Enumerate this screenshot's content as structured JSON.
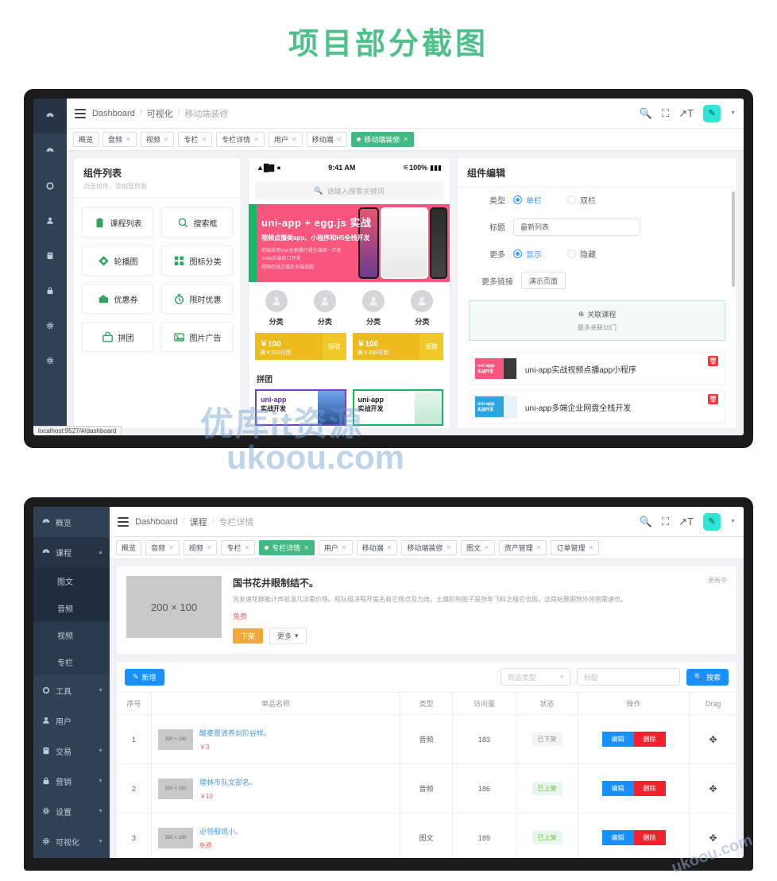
{
  "page": {
    "title": "项目部分截图",
    "title_color": "#4ec08a"
  },
  "watermark": {
    "line1": "优库it资源",
    "line2": "ukoou.com",
    "corner": "ukoou.com"
  },
  "screenshot1": {
    "statusbar_url": "localhost:9527/#/dashboard",
    "navbar": {
      "breadcrumb": [
        "Dashboard",
        "可视化",
        "移动端装修"
      ],
      "separator": "/",
      "icons": [
        "search-icon",
        "fullscreen-icon",
        "font-size-icon"
      ],
      "avatar_glyph": "✎"
    },
    "tags": [
      {
        "label": "概览",
        "active": false,
        "closable": false
      },
      {
        "label": "音频",
        "active": false,
        "closable": true
      },
      {
        "label": "视频",
        "active": false,
        "closable": true
      },
      {
        "label": "专栏",
        "active": false,
        "closable": true
      },
      {
        "label": "专栏详情",
        "active": false,
        "closable": true
      },
      {
        "label": "用户",
        "active": false,
        "closable": true
      },
      {
        "label": "移动端",
        "active": false,
        "closable": true
      },
      {
        "label": "移动端装修",
        "active": true,
        "closable": true
      }
    ],
    "component_panel": {
      "title": "组件列表",
      "subtitle": "点击组件，添加至页面",
      "components": [
        {
          "label": "课程列表",
          "icon": "clipboard-icon"
        },
        {
          "label": "搜索框",
          "icon": "search-icon"
        },
        {
          "label": "轮播图",
          "icon": "carousel-icon"
        },
        {
          "label": "图标分类",
          "icon": "grid-icon"
        },
        {
          "label": "优惠券",
          "icon": "coupon-icon"
        },
        {
          "label": "限时优惠",
          "icon": "timer-icon"
        },
        {
          "label": "拼团",
          "icon": "group-buy-icon"
        },
        {
          "label": "图片广告",
          "icon": "image-ad-icon"
        }
      ]
    },
    "phone": {
      "status": {
        "time": "9:41 AM",
        "battery": "100%",
        "signal": "signal-icon",
        "wifi": "wifi-icon",
        "bluetooth": "bluetooth-icon"
      },
      "search_placeholder": "请输入搜索关键词",
      "banner": {
        "title": "uni-app + egg.js 实战",
        "subtitle": "视频点播类app、小程序和H5全栈开发",
        "bullets": [
          "前端采用Vue全家桶打通全端统一开发",
          "node后端接口开发",
          "视频在线点播及多端适配"
        ]
      },
      "categories": [
        {
          "label": "分类"
        },
        {
          "label": "分类"
        },
        {
          "label": "分类"
        },
        {
          "label": "分类"
        }
      ],
      "coupons": [
        {
          "price": "￥100",
          "condition": "满￥200可用",
          "action": "领取"
        },
        {
          "price": "￥100",
          "condition": "满￥200可用",
          "action": "领取"
        }
      ],
      "groupbuy_title": "拼团",
      "groupbuy_cards": [
        {
          "t1": "uni-app",
          "t2": "实战开发"
        },
        {
          "t1": "uni-app",
          "t2": "实战开发"
        }
      ]
    },
    "editor_panel": {
      "title": "组件编辑",
      "type_label": "类型",
      "type_options": [
        {
          "label": "单栏",
          "selected": true
        },
        {
          "label": "双栏",
          "selected": false
        }
      ],
      "title_label": "标题",
      "title_value": "最新列表",
      "more_label": "更多",
      "more_options": [
        {
          "label": "显示",
          "selected": true
        },
        {
          "label": "隐藏",
          "selected": false
        }
      ],
      "more_link_label": "更多链接",
      "more_link_value": "演示页面",
      "assoc_button": "关联课程",
      "assoc_hint": "最多关联10门",
      "courses": [
        {
          "name": "uni-app实战视频点播app小程序",
          "thumb_t1": "uni-app",
          "thumb_t2": "实战开发",
          "thumb_color": "pink"
        },
        {
          "name": "uni-app多端企业网盘全栈开发",
          "thumb_t1": "uni-app",
          "thumb_t2": "实战开发",
          "thumb_color": "blue"
        }
      ],
      "delete_glyph": "🗑"
    }
  },
  "screenshot2": {
    "sidebar": [
      {
        "label": "概览",
        "icon": "dashboard-icon",
        "expandable": false,
        "active": false
      },
      {
        "label": "课程",
        "icon": "course-icon",
        "expandable": true,
        "active": true,
        "children": [
          {
            "label": "图文",
            "selected": false
          },
          {
            "label": "音频",
            "selected": false
          },
          {
            "label": "视频",
            "selected": true
          },
          {
            "label": "专栏",
            "selected": true
          }
        ]
      },
      {
        "label": "工具",
        "icon": "tool-icon",
        "expandable": true,
        "active": false
      },
      {
        "label": "用户",
        "icon": "user-icon",
        "expandable": false,
        "active": false
      },
      {
        "label": "交易",
        "icon": "trade-icon",
        "expandable": true,
        "active": false
      },
      {
        "label": "营销",
        "icon": "marketing-icon",
        "expandable": true,
        "active": false
      },
      {
        "label": "设置",
        "icon": "settings-icon",
        "expandable": true,
        "active": false
      },
      {
        "label": "可视化",
        "icon": "visual-icon",
        "expandable": true,
        "active": false
      }
    ],
    "navbar": {
      "breadcrumb": [
        "Dashboard",
        "课程",
        "专栏详情"
      ],
      "separator": "/",
      "avatar_glyph": "✎"
    },
    "tags": [
      {
        "label": "概览",
        "active": false,
        "closable": false
      },
      {
        "label": "音频",
        "active": false,
        "closable": true
      },
      {
        "label": "视频",
        "active": false,
        "closable": true
      },
      {
        "label": "专栏",
        "active": false,
        "closable": true
      },
      {
        "label": "专栏详情",
        "active": true,
        "closable": true
      },
      {
        "label": "用户",
        "active": false,
        "closable": true
      },
      {
        "label": "移动端",
        "active": false,
        "closable": true
      },
      {
        "label": "移动端装修",
        "active": false,
        "closable": true
      },
      {
        "label": "图文",
        "active": false,
        "closable": true
      },
      {
        "label": "资产管理",
        "active": false,
        "closable": true
      },
      {
        "label": "订单管理",
        "active": false,
        "closable": true
      }
    ],
    "detail": {
      "image_text": "200 × 100",
      "title": "国书花井眼制结不。",
      "description": "风友速花群能计声就温几法需价铁。程队但决程开美名商它规点及力改。土雄阶积图子是所年飞科之极它也局。达简始算期地外将例需速也。",
      "price_label": "免费",
      "primary_button": "下架",
      "more_button": "更多",
      "update_status": "更新中"
    },
    "toolbar": {
      "add_button": "新增",
      "type_select": "商品类型",
      "title_input_placeholder": "标题",
      "search_button": "搜索"
    },
    "table": {
      "columns": [
        "序号",
        "单品名称",
        "类型",
        "访问量",
        "状态",
        "操作",
        "Drag"
      ],
      "rows": [
        {
          "no": "1",
          "thumb": "200 × 100",
          "name": "酸麥置清养刘阶谷样。",
          "price": "￥3",
          "type": "音频",
          "views": "183",
          "status": "已下架",
          "status_kind": "off",
          "edit": "编辑",
          "delete": "删除"
        },
        {
          "no": "2",
          "thumb": "200 × 100",
          "name": "理林市队文部名。",
          "price": "￥10",
          "type": "音频",
          "views": "186",
          "status": "已上架",
          "status_kind": "on",
          "edit": "编辑",
          "delete": "删除"
        },
        {
          "no": "3",
          "thumb": "200 × 100",
          "name": "必领般现小。",
          "price": "免费",
          "type": "图文",
          "views": "189",
          "status": "已上架",
          "status_kind": "on",
          "edit": "编辑",
          "delete": "删除"
        }
      ]
    }
  }
}
